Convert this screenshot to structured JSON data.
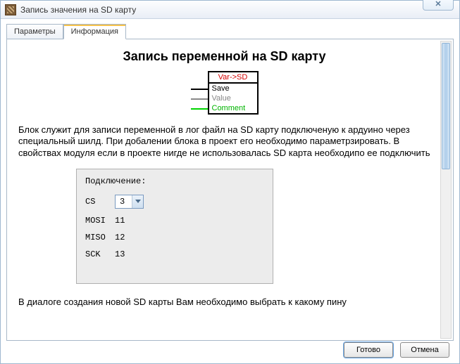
{
  "window": {
    "title": "Запись значения на SD карту",
    "close_glyph": "✕"
  },
  "tabs": {
    "parameters": "Параметры",
    "information": "Информация"
  },
  "page": {
    "heading": "Запись переменной на SD карту"
  },
  "block": {
    "header": "Var->SD",
    "row_save": "Save",
    "row_value": "Value",
    "row_comment": "Comment"
  },
  "description": "Блок служит для записи переменной в лог файл на SD карту подключеную к ардуино через специальный шилд. При добалении блока в проект его необходимо параметрзировать. В свойствах модуля если в проекте нигде не использовалась SD карта необходипо ее подключить",
  "connection": {
    "title": "Подключение:",
    "cs_label": "CS",
    "cs_value": "3",
    "mosi_label": "MOSI",
    "mosi_value": "11",
    "miso_label": "MISO",
    "miso_value": "12",
    "sck_label": "SCK",
    "sck_value": "13"
  },
  "description2": "В диалоге создания новой SD карты Вам необходимо выбрать к какому пину",
  "buttons": {
    "ok": "Готово",
    "cancel": "Отмена"
  }
}
